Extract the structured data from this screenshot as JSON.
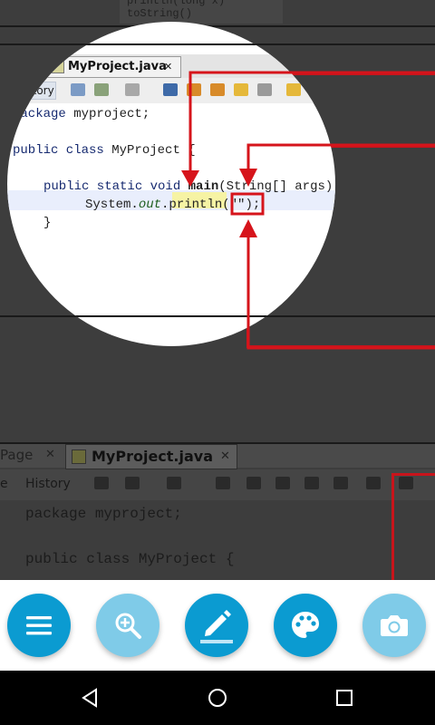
{
  "editor": {
    "tab_partial": "Page",
    "tab_title": "MyProject.java",
    "tab_close": "✕",
    "history_label": "History",
    "history_partial": "e",
    "code_line1_kw": "package",
    "code_line1_rest": " myproject;",
    "code_line2_kw": "public class",
    "code_line2_rest": " MyProject {",
    "code_line3_kw": "public static void",
    "code_line3_name": " main",
    "code_line3_rest": "(String[] args) {",
    "code_line4_pre": "System.",
    "code_line4_out": "out",
    "code_line4_post": ".println(\"\");",
    "code_line5": "}",
    "code_line6": "}",
    "top_snippet1": "println(long x)",
    "top_snippet2": "toString()"
  },
  "actions": {
    "menu": "menu-icon",
    "zoom": "zoom-in-icon",
    "draw": "pencil-icon",
    "color": "palette-icon",
    "capture": "camera-icon"
  },
  "colors": {
    "primary": "#0b9bd1",
    "light_primary": "#7fcbe8",
    "annotation_red": "#c8141b",
    "highlight": "#f6f3a4"
  }
}
